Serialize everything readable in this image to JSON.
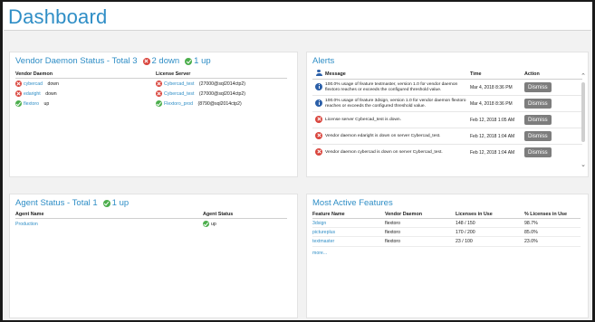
{
  "page": {
    "title": "Dashboard"
  },
  "colors": {
    "accent": "#2f8ec6",
    "error": "#d9453d",
    "ok": "#4cae4c",
    "info": "#2b5fa8",
    "button": "#7d7d7d"
  },
  "vendor_panel": {
    "title": "Vendor Daemon Status - Total 3",
    "down_count": "2 down",
    "up_count": "1 up",
    "columns": [
      "Vendor Daemon",
      "License Server"
    ],
    "rows": [
      {
        "status": "down",
        "daemon": "cybercad",
        "daemon_status": "down",
        "server": "Cybercad_test",
        "server_status": "down",
        "server_detail": "(27000@sql2014ctp2)"
      },
      {
        "status": "down",
        "daemon": "edaright",
        "daemon_status": "down",
        "server": "Cybercad_test",
        "server_status": "down",
        "server_detail": "(27000@sql2014ctp2)"
      },
      {
        "status": "up",
        "daemon": "flextoro",
        "daemon_status": "up",
        "server": "Flextoro_prod",
        "server_status": "up",
        "server_detail": "(8790@sql2014ctp2)"
      }
    ]
  },
  "alerts_panel": {
    "title": "Alerts",
    "columns": [
      "Message",
      "Time",
      "Action"
    ],
    "dismiss_label": "Dismiss",
    "rows": [
      {
        "level": "info",
        "message": "100.0% usage of feature textmaster, version 1.0 for vendor daemon flextoro reaches or exceeds the configured threshold value.",
        "time": "Mar 4, 2018 8:36 PM"
      },
      {
        "level": "info",
        "message": "100.0% usage of feature 3dsign, version 1.0 for vendor daemon flextoro reaches or exceeds the configured threshold value.",
        "time": "Mar 4, 2018 8:36 PM"
      },
      {
        "level": "error",
        "message": "License server Cybercad_test is down.",
        "time": "Feb 12, 2018 1:05 AM"
      },
      {
        "level": "error",
        "message": "Vendor daemon edaright is down on server Cybercad_test.",
        "time": "Feb 12, 2018 1:04 AM"
      },
      {
        "level": "error",
        "message": "Vendor daemon cybercad is down on server Cybercad_test.",
        "time": "Feb 12, 2018 1:04 AM"
      }
    ]
  },
  "agent_panel": {
    "title": "Agent Status - Total 1",
    "up_count": "1 up",
    "columns": [
      "Agent Name",
      "Agent Status"
    ],
    "rows": [
      {
        "name": "Production",
        "status": "up"
      }
    ]
  },
  "features_panel": {
    "title": "Most Active Features",
    "columns": [
      "Feature Name",
      "Vendor Daemon",
      "Licenses in Use",
      "% Licenses in Use"
    ],
    "rows": [
      {
        "feature": "3dsign",
        "daemon": "flextoro",
        "licenses": "148 / 150",
        "percent": "98.7%"
      },
      {
        "feature": "pictureplus",
        "daemon": "flextoro",
        "licenses": "170 / 200",
        "percent": "85.0%"
      },
      {
        "feature": "textmaster",
        "daemon": "flextoro",
        "licenses": "23 / 100",
        "percent": "23.0%"
      }
    ],
    "more_label": "more..."
  }
}
